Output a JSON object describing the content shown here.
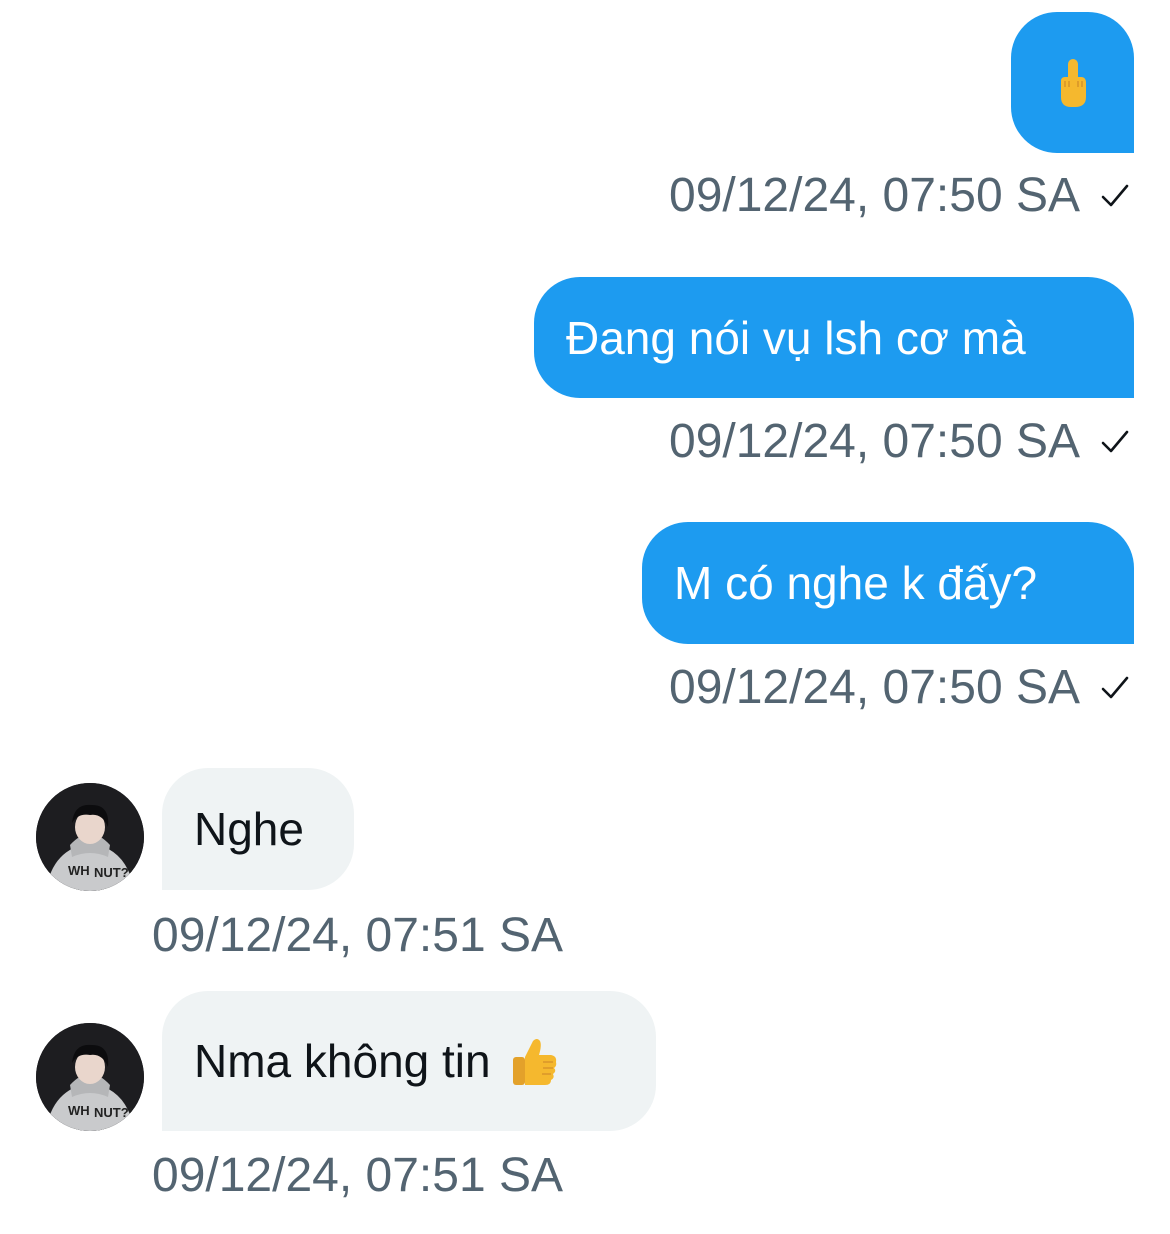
{
  "messages": [
    {
      "direction": "outgoing",
      "type": "emoji",
      "emoji": "middle-finger-emoji",
      "timestamp": "09/12/24, 07:50 SA",
      "status": "sent-check-icon"
    },
    {
      "direction": "outgoing",
      "text": "Đang nói vụ lsh cơ mà",
      "timestamp": "09/12/24, 07:50 SA",
      "status": "sent-check-icon"
    },
    {
      "direction": "outgoing",
      "text": "M có nghe k đấy?",
      "timestamp": "09/12/24, 07:50 SA",
      "status": "sent-check-icon"
    },
    {
      "direction": "incoming",
      "text": "Nghe",
      "timestamp": "09/12/24, 07:51 SA",
      "avatar": "avatar"
    },
    {
      "direction": "incoming",
      "text": "Nma không tin",
      "trailing_emoji": "thumbs-up-emoji",
      "timestamp": "09/12/24, 07:51 SA",
      "avatar": "avatar"
    }
  ],
  "colors": {
    "outgoing_bubble": "#1d9bf0",
    "incoming_bubble": "#eff3f4",
    "timestamp_text": "#536471",
    "incoming_text": "#0f1419"
  }
}
